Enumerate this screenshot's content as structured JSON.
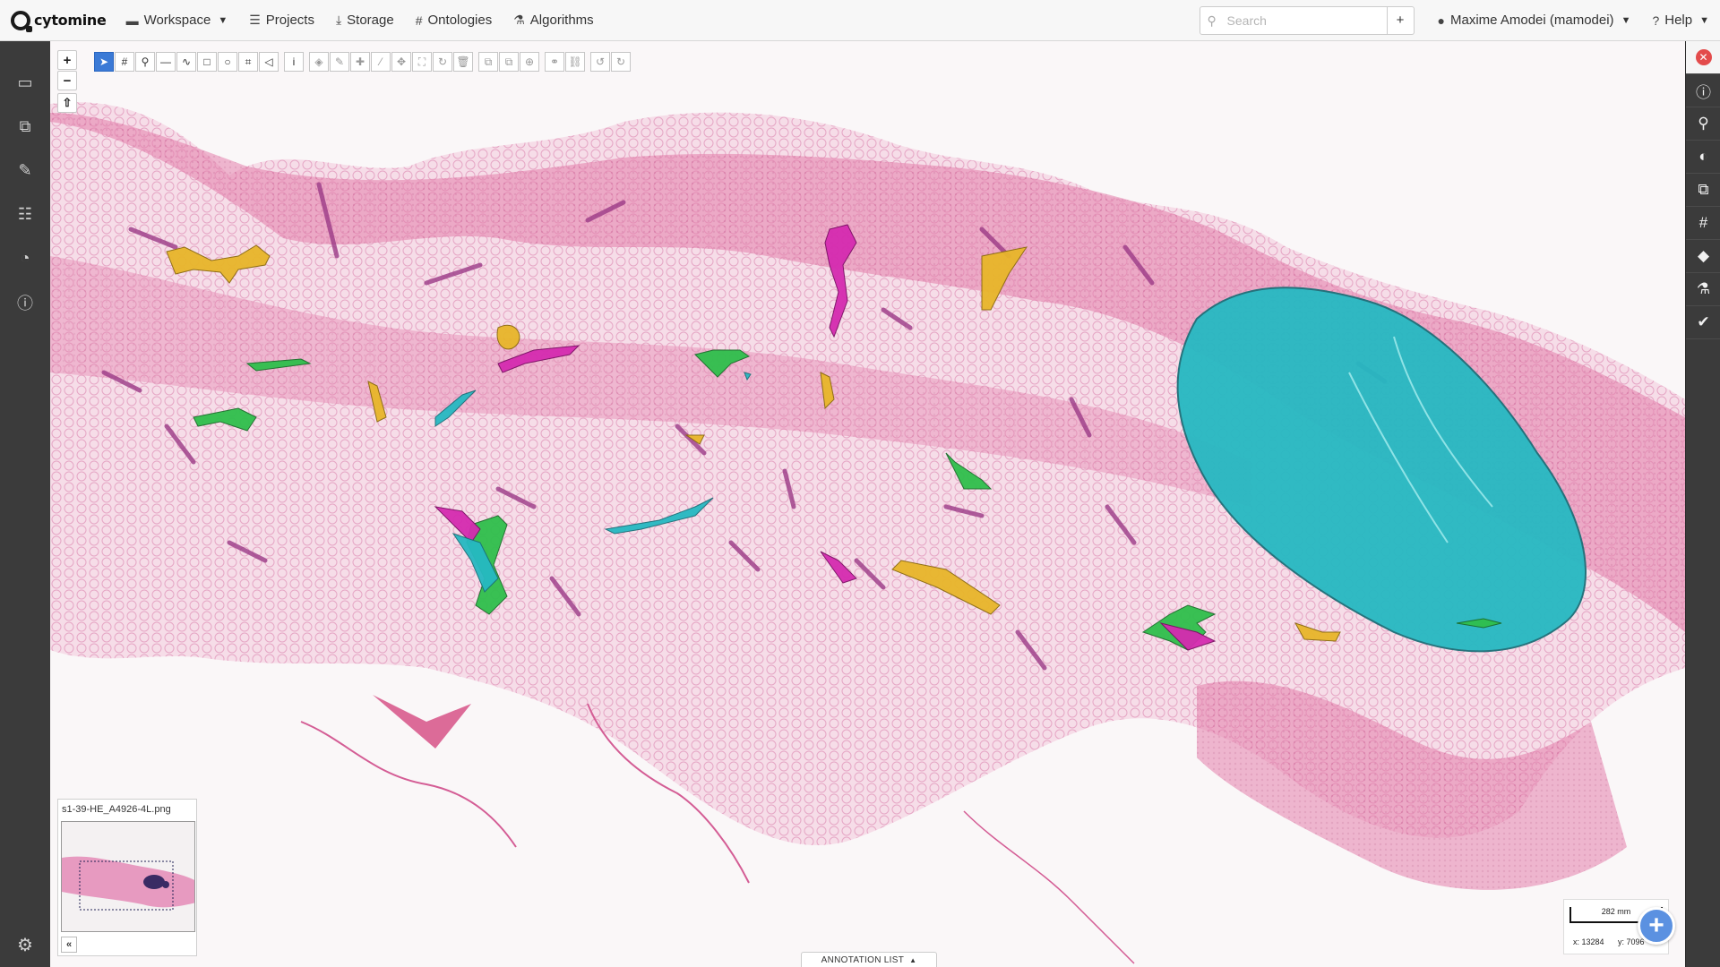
{
  "app": {
    "logo_text": "cytomine"
  },
  "nav": {
    "items": [
      {
        "label": "Workspace",
        "icon": "folder-icon",
        "caret": true
      },
      {
        "label": "Projects",
        "icon": "list-icon",
        "caret": false
      },
      {
        "label": "Storage",
        "icon": "download-icon",
        "caret": false
      },
      {
        "label": "Ontologies",
        "icon": "hashtag-icon",
        "caret": false
      },
      {
        "label": "Algorithms",
        "icon": "flask-icon",
        "caret": false
      }
    ],
    "search_placeholder": "Search",
    "search_add": "+",
    "user": "Maxime Amodei (mamodei)",
    "help": "Help"
  },
  "left_sidebar": [
    "image-icon",
    "images-icon",
    "edit-icon",
    "tasks-icon",
    "dashboard-icon",
    "info-icon"
  ],
  "left_sidebar_bottom": "settings-icon",
  "right_sidebar": [
    "close-icon",
    "info-icon",
    "search-icon",
    "contrast-icon",
    "copy-icon",
    "hashtag-icon",
    "tag-icon",
    "microscope-icon",
    "check-circle-icon"
  ],
  "viewer": {
    "zoom_in": "+",
    "zoom_out": "−",
    "rotate": "⇧",
    "tools": [
      "select",
      "#",
      "⚲",
      "—",
      "∿",
      "□",
      "○",
      "⌗",
      "◁",
      "i",
      "✎",
      "✐",
      "✚",
      "⁄",
      "✥",
      "⛶",
      "↻",
      "🗑",
      "⧉",
      "⧉",
      "⊕",
      "⚭",
      "⛓",
      "↺",
      "↻"
    ],
    "image_name": "s1-39-HE_A4926-4L.png",
    "overview_collapse": "«",
    "scale_label": "282 mm",
    "coord_x": "x: 13284",
    "coord_y": "y: 7096",
    "scale_more": "»",
    "annotation_list": "ANNOTATION LIST",
    "annotation_list_arrow": "▲"
  },
  "colors": {
    "tissue": "#e88fb6",
    "tissue_dark": "#c25a8c",
    "annot_yellow": "#e8b62a",
    "annot_green": "#2fbf4c",
    "annot_magenta": "#d52bb0",
    "annot_cyan": "#26b9c2",
    "accent_blue": "#3b7ad6"
  }
}
